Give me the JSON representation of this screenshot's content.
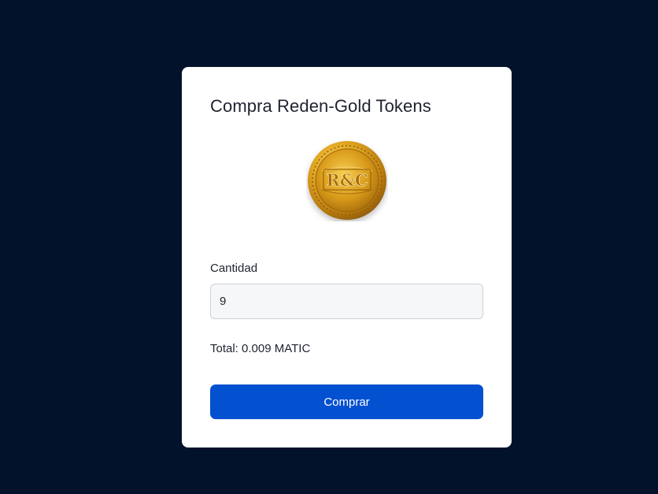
{
  "card": {
    "title": "Compra Reden-Gold Tokens",
    "coin_text": "R&C"
  },
  "form": {
    "quantity_label": "Cantidad",
    "quantity_value": "9",
    "total_text": "Total: 0.009 MATIC",
    "buy_label": "Comprar"
  },
  "colors": {
    "background": "#02122b",
    "card": "#ffffff",
    "button": "#0350d1",
    "coin_gold": "#d9a21e"
  },
  "icons": {
    "coin": "gold-coin-icon"
  }
}
